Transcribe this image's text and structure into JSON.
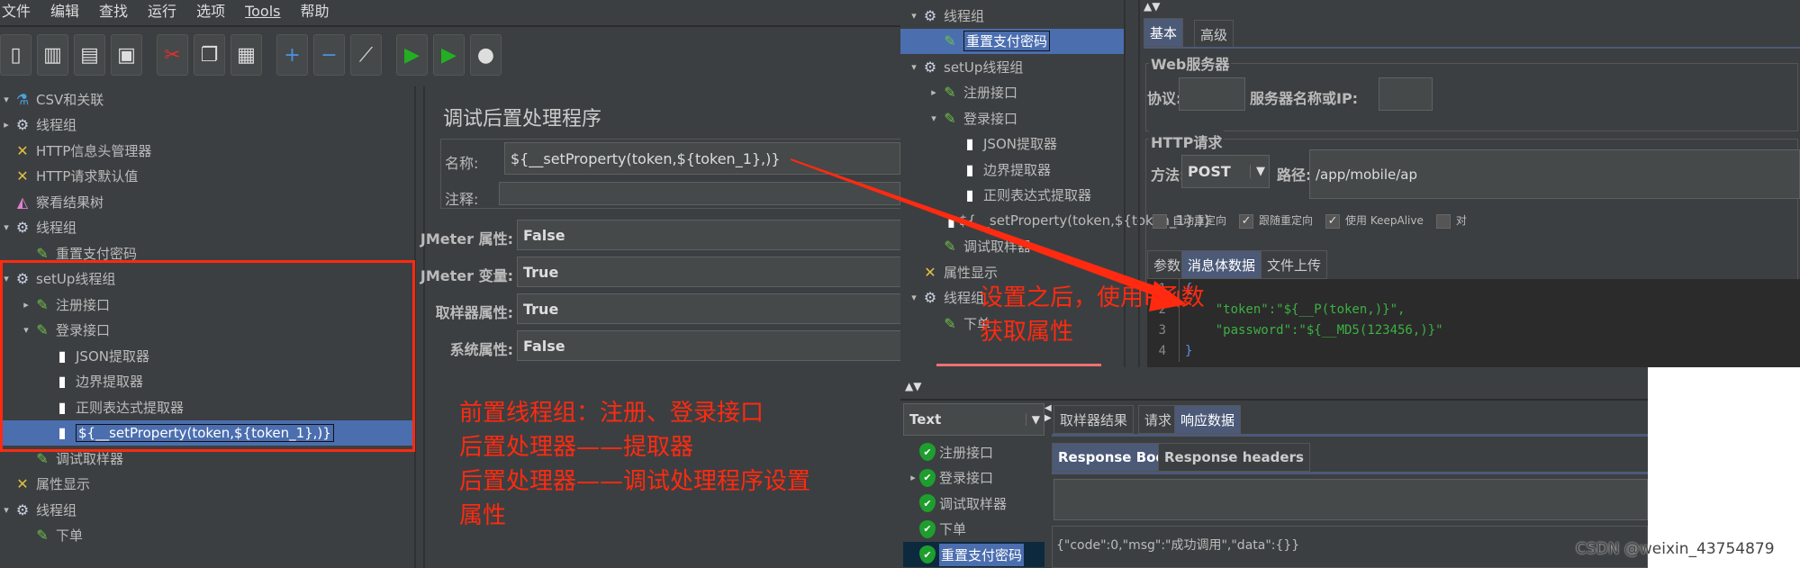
{
  "left_window": {
    "menu": [
      "文件",
      "编辑",
      "查找",
      "运行",
      "选项",
      "Tools",
      "帮助"
    ],
    "toolbar": [
      {
        "icon": "new-icon",
        "sym": "▯"
      },
      {
        "icon": "templates-icon",
        "sym": "▥"
      },
      {
        "icon": "open-icon",
        "sym": "▤"
      },
      {
        "icon": "save-icon",
        "sym": "▣"
      },
      {
        "icon": "cut-icon",
        "sym": "✂"
      },
      {
        "icon": "copy-icon",
        "sym": "❐"
      },
      {
        "icon": "paste-icon",
        "sym": "▦"
      },
      {
        "icon": "expand-icon",
        "sym": "+"
      },
      {
        "icon": "collapse-icon",
        "sym": "−"
      },
      {
        "icon": "toggle-icon",
        "sym": "⟋"
      },
      {
        "icon": "start-icon",
        "sym": "▶"
      },
      {
        "icon": "start-no-pause-icon",
        "sym": "▶"
      },
      {
        "icon": "stop-icon",
        "sym": "●"
      }
    ],
    "tree": [
      {
        "label": "CSV和关联",
        "icon": "flask",
        "level": 0,
        "arrow": "▾"
      },
      {
        "label": "线程组",
        "icon": "gear",
        "level": 0,
        "arrow": "▸"
      },
      {
        "label": "HTTP信息头管理器",
        "icon": "tools",
        "level": 0,
        "arrow": ""
      },
      {
        "label": "HTTP请求默认值",
        "icon": "tools",
        "level": 0,
        "arrow": ""
      },
      {
        "label": "察看结果树",
        "icon": "chart",
        "level": 0,
        "arrow": ""
      },
      {
        "label": "线程组",
        "icon": "gear",
        "level": 0,
        "arrow": "▾"
      },
      {
        "label": "重置支付密码",
        "icon": "pipette",
        "level": 1,
        "arrow": ""
      },
      {
        "label": "setUp线程组",
        "icon": "gear",
        "level": 0,
        "arrow": "▾"
      },
      {
        "label": "注册接口",
        "icon": "pipette",
        "level": 1,
        "arrow": "▸"
      },
      {
        "label": "登录接口",
        "icon": "pipette",
        "level": 1,
        "arrow": "▾"
      },
      {
        "label": "JSON提取器",
        "icon": "doc",
        "level": 2,
        "arrow": ""
      },
      {
        "label": "边界提取器",
        "icon": "doc",
        "level": 2,
        "arrow": ""
      },
      {
        "label": "正则表达式提取器",
        "icon": "doc",
        "level": 2,
        "arrow": ""
      },
      {
        "label": "${__setProperty(token,${token_1},)}",
        "icon": "doc",
        "level": 2,
        "arrow": "",
        "selected": true
      },
      {
        "label": "调试取样器",
        "icon": "pipette",
        "level": 1,
        "arrow": ""
      },
      {
        "label": "属性显示",
        "icon": "tools",
        "level": 0,
        "arrow": ""
      },
      {
        "label": "线程组",
        "icon": "gear",
        "level": 0,
        "arrow": "▾"
      },
      {
        "label": "下单",
        "icon": "pipette",
        "level": 1,
        "arrow": ""
      }
    ],
    "editor": {
      "title": "调试后置处理程序",
      "name_label": "名称:",
      "name_value": "${__setProperty(token,${token_1},)}",
      "comment_label": "注释:",
      "comment_value": "",
      "fields": [
        {
          "label": "JMeter 属性:",
          "value": "False"
        },
        {
          "label": "JMeter 变量:",
          "value": "True"
        },
        {
          "label": "取样器属性:",
          "value": "True"
        },
        {
          "label": "系统属性:",
          "value": "False"
        }
      ]
    },
    "annotation": [
      "前置线程组：注册、登录接口",
      "后置处理器——提取器",
      "后置处理器——调试处理程序设置",
      "属性"
    ]
  },
  "right_top_window": {
    "tree": [
      {
        "label": "线程组",
        "icon": "gear",
        "level": 0,
        "arrow": "▾"
      },
      {
        "label": "重置支付密码",
        "icon": "pipette",
        "level": 1,
        "arrow": "",
        "selected": true
      },
      {
        "label": "setUp线程组",
        "icon": "gear",
        "level": 0,
        "arrow": "▾"
      },
      {
        "label": "注册接口",
        "icon": "pipette",
        "level": 1,
        "arrow": "▸"
      },
      {
        "label": "登录接口",
        "icon": "pipette",
        "level": 1,
        "arrow": "▾"
      },
      {
        "label": "JSON提取器",
        "icon": "doc",
        "level": 2,
        "arrow": ""
      },
      {
        "label": "边界提取器",
        "icon": "doc",
        "level": 2,
        "arrow": ""
      },
      {
        "label": "正则表达式提取器",
        "icon": "doc",
        "level": 2,
        "arrow": ""
      },
      {
        "label": "${__setProperty(token,${token_1},)}",
        "icon": "doc",
        "level": 2,
        "arrow": ""
      },
      {
        "label": "调试取样器",
        "icon": "pipette",
        "level": 1,
        "arrow": ""
      },
      {
        "label": "属性显示",
        "icon": "tools",
        "level": 0,
        "arrow": ""
      },
      {
        "label": "线程组",
        "icon": "gear",
        "level": 0,
        "arrow": "▾"
      },
      {
        "label": "下单",
        "icon": "pipette",
        "level": 1,
        "arrow": ""
      }
    ],
    "tabs": [
      "基本",
      "高级"
    ],
    "web_server": {
      "legend": "Web服务器",
      "protocol_label": "协议:",
      "protocol_value": "",
      "server_label": "服务器名称或IP:",
      "server_value": ""
    },
    "http_request": {
      "legend": "HTTP请求",
      "method_label": "方法:",
      "method_value": "POST",
      "path_label": "路径:",
      "path_value": "/app/mobile/ap"
    },
    "checkboxes": [
      {
        "label": "自动重定向",
        "checked": false
      },
      {
        "label": "跟随重定向",
        "checked": true
      },
      {
        "label": "使用 KeepAlive",
        "checked": true
      },
      {
        "label": "对",
        "checked": false
      }
    ],
    "body_tabs": [
      "参数",
      "消息体数据",
      "文件上传"
    ],
    "code_lines": [
      {
        "n": "1",
        "text": "{"
      },
      {
        "n": "2",
        "text": "    \"token\":\"${__P(token,)}\","
      },
      {
        "n": "3",
        "text": "    \"password\":\"${__MD5(123456,)}\""
      },
      {
        "n": "4",
        "text": "}"
      }
    ],
    "annotation": [
      "设置之后，使用P函数",
      "获取属性"
    ]
  },
  "right_bottom_window": {
    "renderer": "Text",
    "results": [
      {
        "label": "注册接口",
        "arrow": ""
      },
      {
        "label": "登录接口",
        "arrow": "▸"
      },
      {
        "label": "调试取样器",
        "arrow": ""
      },
      {
        "label": "下单",
        "arrow": ""
      },
      {
        "label": "重置支付密码",
        "arrow": "",
        "selected": true
      }
    ],
    "tabs": [
      "取样器结果",
      "请求",
      "响应数据"
    ],
    "sub_tabs": [
      "Response Body",
      "Response headers"
    ],
    "response": "{\"code\":0,\"msg\":\"成功调用\",\"data\":{}}"
  },
  "watermark": "CSDN @weixin_43754879",
  "colors": {
    "annotation": "#ff2a10",
    "selection": "#4b6eaf",
    "background": "#3c3f41",
    "code_green": "#3cb043"
  }
}
